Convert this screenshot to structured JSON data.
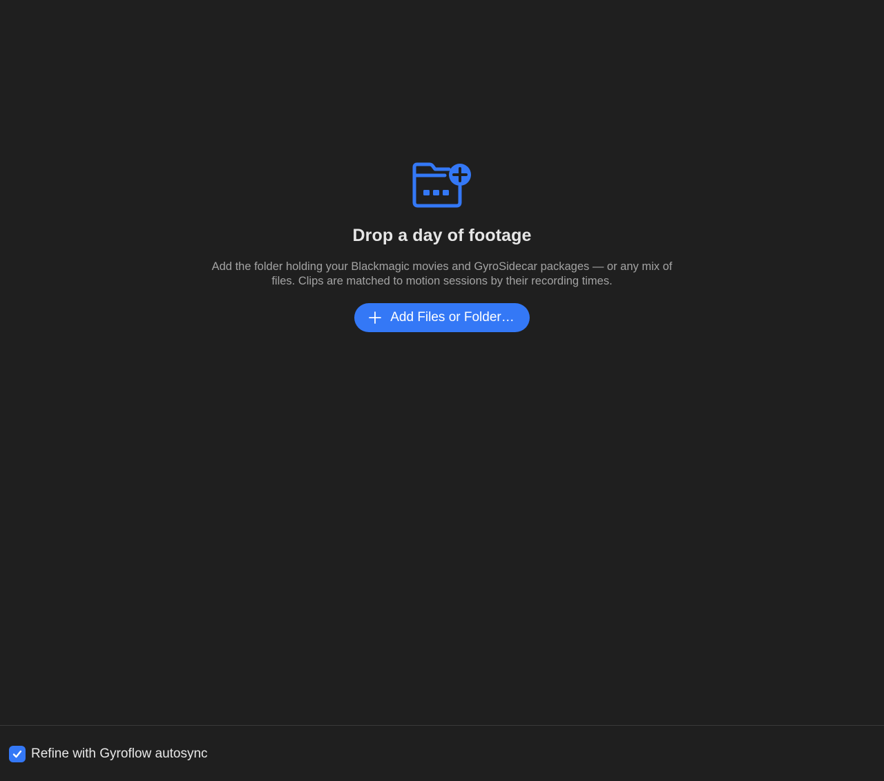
{
  "colors": {
    "background": "#1f1f1f",
    "accent": "#3478f6",
    "title_text": "#e6e6e6",
    "secondary_text": "#a3a3a3",
    "divider": "#3a3a3a"
  },
  "empty_state": {
    "icon": "folder-plus-icon",
    "title": "Drop a day of footage",
    "description": "Add the folder holding your Blackmagic movies and GyroSidecar packages — or any mix of files. Clips are matched to motion sessions by their recording times.",
    "add_button": {
      "icon": "plus-icon",
      "label": "Add Files or Folder…"
    }
  },
  "footer": {
    "autosync": {
      "label": "Refine with Gyroflow autosync",
      "checked": true,
      "icon": "checkmark-icon"
    }
  }
}
